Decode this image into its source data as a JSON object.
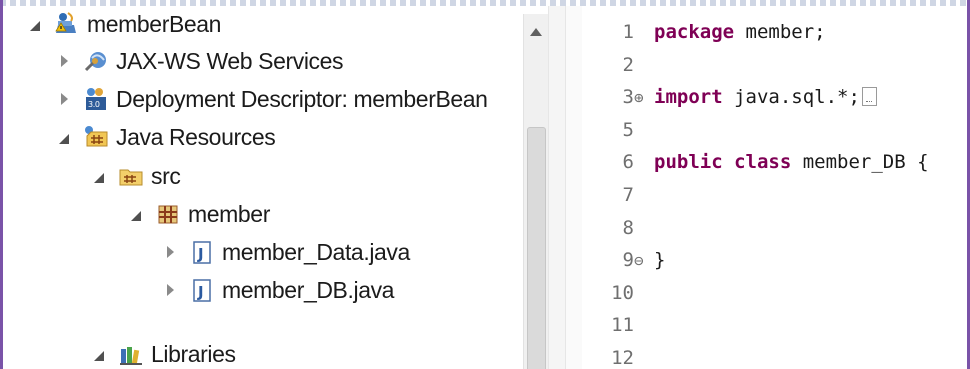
{
  "project_tree": {
    "items": [
      {
        "label": "memberBean",
        "icon": "project-warning-icon",
        "level": 0,
        "state": "expanded"
      },
      {
        "label": "JAX-WS Web Services",
        "icon": "web-services-icon",
        "level": 1,
        "state": "collapsed"
      },
      {
        "label": "Deployment Descriptor: memberBean",
        "icon": "deployment-descriptor-icon",
        "level": 1,
        "state": "collapsed"
      },
      {
        "label": "Java Resources",
        "icon": "java-resources-icon",
        "level": 1,
        "state": "expanded"
      },
      {
        "label": "src",
        "icon": "source-folder-icon",
        "level": 2,
        "state": "expanded"
      },
      {
        "label": "member",
        "icon": "package-icon",
        "level": 3,
        "state": "expanded"
      },
      {
        "label": "member_Data.java",
        "icon": "java-file-icon",
        "level": 4,
        "state": "collapsed"
      },
      {
        "label": "member_DB.java",
        "icon": "java-file-icon",
        "level": 4,
        "state": "collapsed"
      },
      {
        "label": "Libraries",
        "icon": "libraries-icon",
        "level": 2,
        "state": "expanded"
      }
    ]
  },
  "editor": {
    "lines": [
      {
        "num": "1",
        "fold": "",
        "kw": "package",
        "text": " member;"
      },
      {
        "num": "2",
        "fold": "",
        "kw": "",
        "text": ""
      },
      {
        "num": "3",
        "fold": "⊕",
        "kw": "import",
        "text": " java.sql.*;",
        "collapsed": true
      },
      {
        "num": "5",
        "fold": "",
        "kw": "",
        "text": ""
      },
      {
        "num": "6",
        "fold": "",
        "kw": "public class",
        "text": " member_DB {"
      },
      {
        "num": "7",
        "fold": "",
        "kw": "",
        "text": ""
      },
      {
        "num": "8",
        "fold": "",
        "kw": "",
        "text": ""
      },
      {
        "num": "9",
        "fold": "⊖",
        "kw": "",
        "text": "}"
      },
      {
        "num": "10",
        "fold": "",
        "kw": "",
        "text": ""
      },
      {
        "num": "11",
        "fold": "",
        "kw": "",
        "text": ""
      },
      {
        "num": "12",
        "fold": "",
        "kw": "",
        "text": ""
      }
    ]
  },
  "colors": {
    "keyword": "#7f0055",
    "window_border": "#7a53a8",
    "line_number": "#6f6f6f"
  }
}
